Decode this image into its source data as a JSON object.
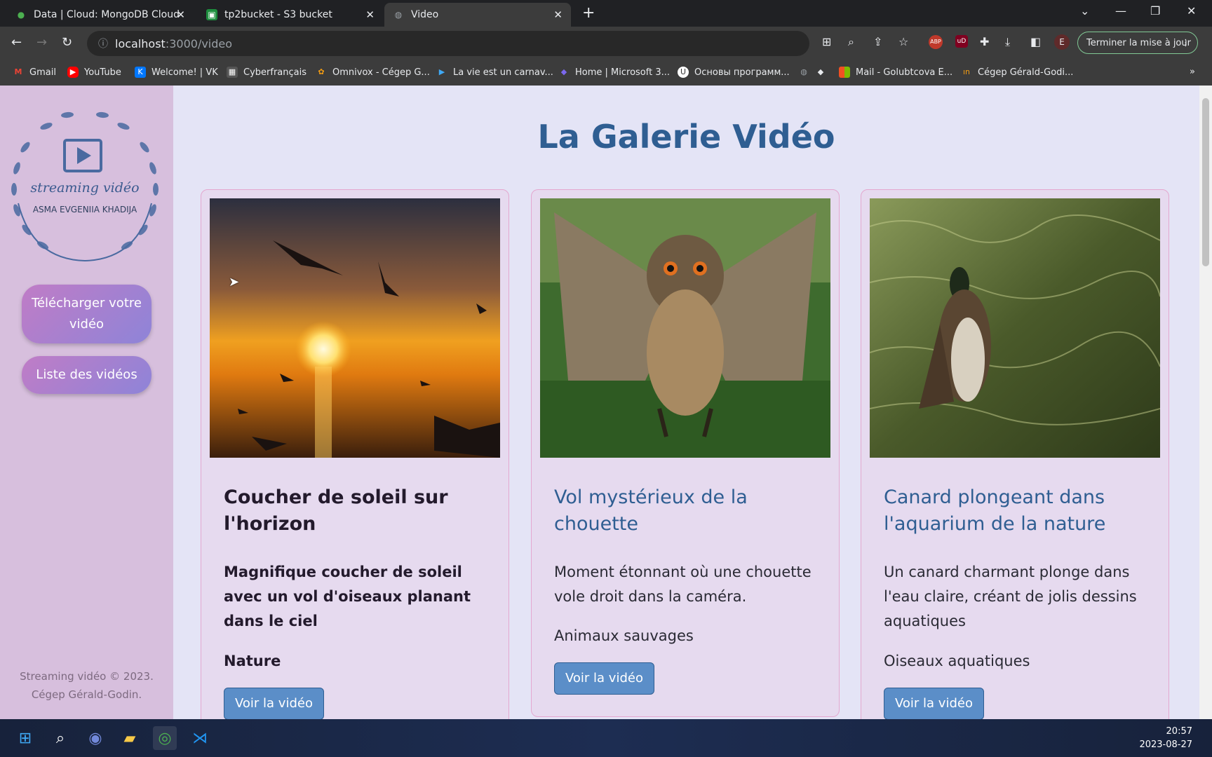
{
  "browser": {
    "tabs": [
      {
        "title": "Data | Cloud: MongoDB Cloud",
        "icon": "mongodb-leaf-icon"
      },
      {
        "title": "tp2bucket - S3 bucket",
        "icon": "s3-bucket-icon"
      },
      {
        "title": "Video",
        "icon": "globe-icon",
        "active": true
      }
    ],
    "url_host": "localhost",
    "url_path": ":3000/video",
    "update_label": "Terminer la mise à jour",
    "profile_initial": "E",
    "bookmarks": [
      {
        "label": "Gmail",
        "icon": "gmail-icon"
      },
      {
        "label": "YouTube",
        "icon": "youtube-icon"
      },
      {
        "label": "Welcome! | VK",
        "icon": "vk-icon"
      },
      {
        "label": "Cyberfrançais",
        "icon": "cyberfrancais-icon"
      },
      {
        "label": "Omnivox - Cégep G...",
        "icon": "omnivox-icon"
      },
      {
        "label": "La vie est un carnav...",
        "icon": "play-icon"
      },
      {
        "label": "Home | Microsoft 3...",
        "icon": "microsoft-icon"
      },
      {
        "label": "Основы программ...",
        "icon": "udemy-icon"
      },
      {
        "label": "Mail - Golubtcova E...",
        "icon": "microsoft-mail-icon"
      },
      {
        "label": "Cégep Gérald-Godi...",
        "icon": "cegep-icon"
      }
    ]
  },
  "sidebar": {
    "logo_text": "streaming vidéo",
    "logo_subtitle": "ASMA EVGENIIA KHADIJA",
    "upload_label": "Télécharger votre vidéo",
    "list_label": "Liste des vidéos",
    "footer_line1": "Streaming vidéo © 2023.",
    "footer_line2": "Cégep Gérald-Godin."
  },
  "page": {
    "title": "La Galerie Vidéo"
  },
  "videos": [
    {
      "title": "Coucher de soleil sur l'horizon",
      "description": "Magnifique coucher de soleil avec un vol d'oiseaux planant dans le ciel",
      "category": "Nature",
      "button": "Voir la vidéo",
      "image": "sunset-birds-thumbnail"
    },
    {
      "title": "Vol mystérieux de la chouette",
      "description": "Moment étonnant où une chouette vole droit dans la caméra.",
      "category": "Animaux sauvages",
      "button": "Voir la vidéo",
      "image": "owl-flying-thumbnail"
    },
    {
      "title": "Canard plongeant dans l'aquarium de la nature",
      "description": "Un canard charmant plonge dans l'eau claire, créant de jolis dessins aquatiques",
      "category": "Oiseaux aquatiques",
      "button": "Voir la vidéo",
      "image": "duck-water-thumbnail"
    }
  ],
  "taskbar": {
    "time": "20:57",
    "date": "2023-08-27"
  }
}
